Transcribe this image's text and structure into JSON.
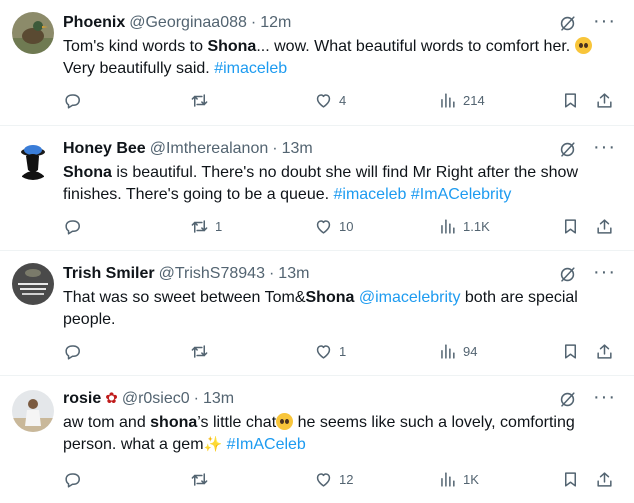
{
  "tweets": [
    {
      "name": "Phoenix",
      "handle": "@Georginaa088",
      "time": "12m",
      "text_parts": [
        "Tom's kind words to ",
        "Shona",
        "... wow. What beautiful words to comfort her. ",
        " Very beautifully said. ",
        "#imaceleb"
      ],
      "replies": "",
      "retweets": "",
      "likes": "4",
      "views": "214"
    },
    {
      "name": "Honey Bee",
      "handle": "@Imtherealanon",
      "time": "13m",
      "text_parts": [
        "Shona",
        " is beautiful. There's no doubt she will find Mr Right after the show finishes. There's going to be a queue. ",
        "#imaceleb",
        " ",
        "#ImACelebrity"
      ],
      "replies": "",
      "retweets": "1",
      "likes": "10",
      "views": "1.1K"
    },
    {
      "name": "Trish Smiler",
      "handle": "@TrishS78943",
      "time": "13m",
      "text_parts": [
        "That was so sweet between Tom&",
        "Shona",
        " ",
        "@imacelebrity",
        " both are special people."
      ],
      "replies": "",
      "retweets": "",
      "likes": "1",
      "views": "94"
    },
    {
      "name": "rosie",
      "handle": "@r0siec0",
      "time": "13m",
      "text_parts": [
        "aw tom and ",
        "shona",
        "’s little chat",
        " he seems like such a lovely, comforting person. what a gem",
        " ",
        "#ImACeleb"
      ],
      "replies": "",
      "retweets": "",
      "likes": "12",
      "views": "1K"
    }
  ],
  "separator": "·",
  "more_label": "···",
  "colors": {
    "link": "#1d9bf0",
    "muted": "#536471",
    "text": "#0f1419"
  },
  "icons": [
    "grok-icon",
    "more-icon",
    "reply-icon",
    "retweet-icon",
    "like-icon",
    "views-icon",
    "bookmark-icon",
    "share-icon"
  ]
}
